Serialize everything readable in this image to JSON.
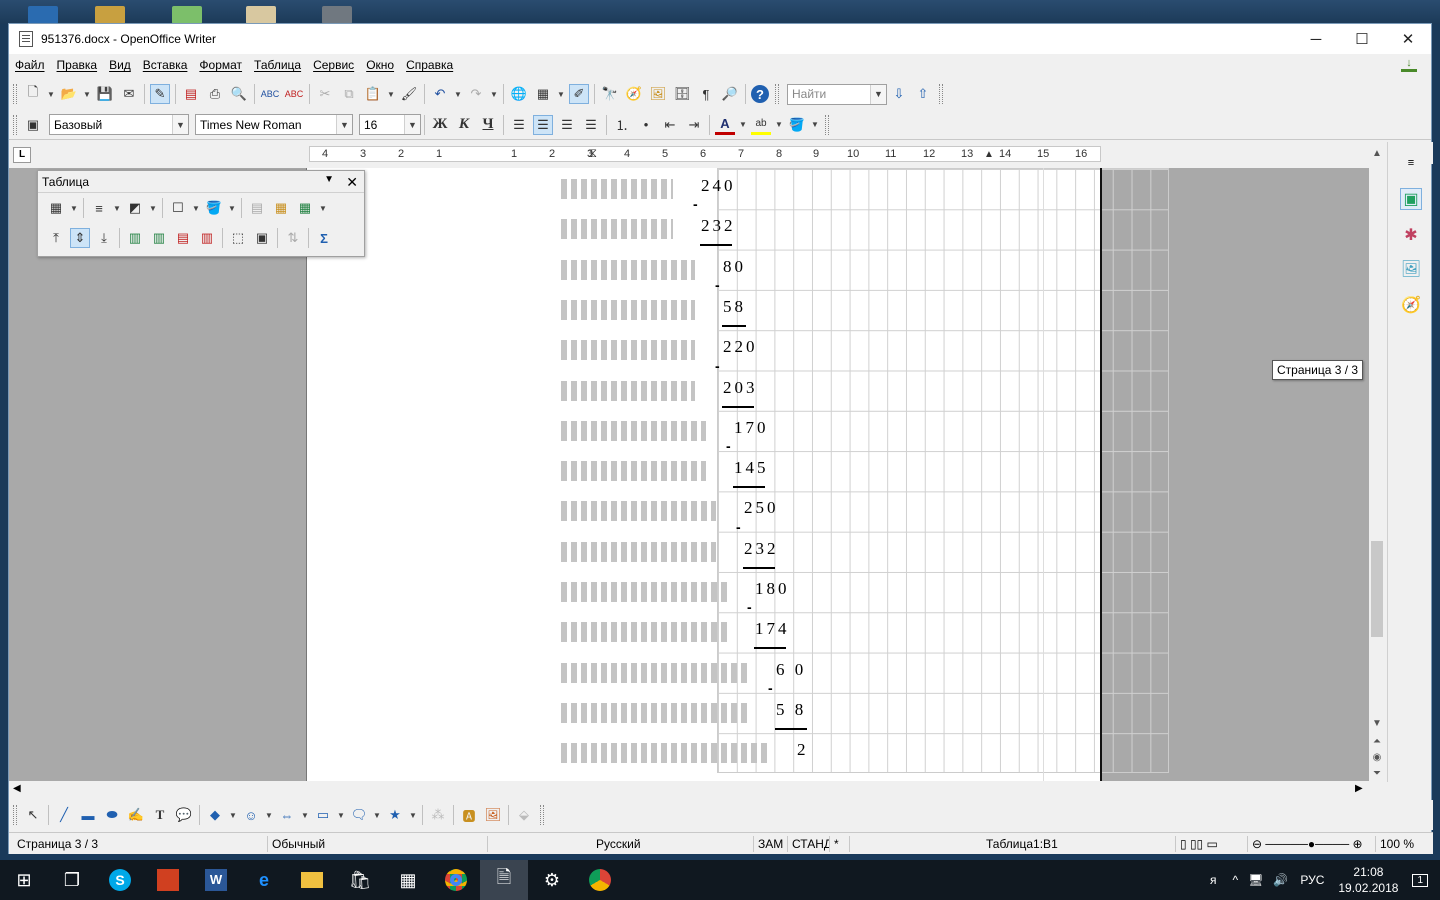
{
  "window": {
    "title": "951376.docx - OpenOffice Writer"
  },
  "window_controls": {
    "minimize": "─",
    "maximize": "☐",
    "close": "✕"
  },
  "menu": [
    "Файл",
    "Правка",
    "Вид",
    "Вставка",
    "Формат",
    "Таблица",
    "Сервис",
    "Окно",
    "Справка"
  ],
  "toolbar": {
    "find_placeholder": "Найти"
  },
  "format": {
    "style": "Базовый",
    "font": "Times New Roman",
    "size": "16",
    "bold": "Ж",
    "italic": "К",
    "underline": "Ч"
  },
  "ruler": {
    "corner": "L",
    "labels": [
      "4",
      "3",
      "2",
      "1",
      "1",
      "2",
      "3",
      "4",
      "5",
      "6",
      "7",
      "8",
      "9",
      "10",
      "11",
      "12",
      "13",
      "14",
      "15",
      "16"
    ]
  },
  "table_toolbar": {
    "title": "Таблица"
  },
  "document": {
    "rows": [
      {
        "num": "240",
        "minus": false,
        "underline": false
      },
      {
        "num": "232",
        "minus": true,
        "underline": true
      },
      {
        "num": "80",
        "minus": false,
        "underline": false
      },
      {
        "num": "58",
        "minus": true,
        "underline": true
      },
      {
        "num": "220",
        "minus": false,
        "underline": false
      },
      {
        "num": "203",
        "minus": true,
        "underline": true
      },
      {
        "num": "170",
        "minus": false,
        "underline": false
      },
      {
        "num": "145",
        "minus": true,
        "underline": true
      },
      {
        "num": "250",
        "minus": false,
        "underline": false
      },
      {
        "num": "232",
        "minus": true,
        "underline": true
      },
      {
        "num": "180",
        "minus": false,
        "underline": false
      },
      {
        "num": "174",
        "minus": true,
        "underline": true
      },
      {
        "num": "6 0",
        "minus": false,
        "underline": false
      },
      {
        "num": "5 8",
        "minus": true,
        "underline": true
      },
      {
        "num": "2",
        "minus": false,
        "underline": false
      }
    ]
  },
  "tooltip": "Страница  3 / 3",
  "status": {
    "page": "Страница  3 / 3",
    "style": "Обычный",
    "language": "Русский",
    "insert": "ЗАМ",
    "selection": "СТАНД",
    "modified": "*",
    "cell": "Таблица1:B1",
    "zoom": "100 %"
  },
  "taskbar": {
    "lang": "РУС",
    "time": "21:08",
    "date": "19.02.2018",
    "notif": "1"
  }
}
